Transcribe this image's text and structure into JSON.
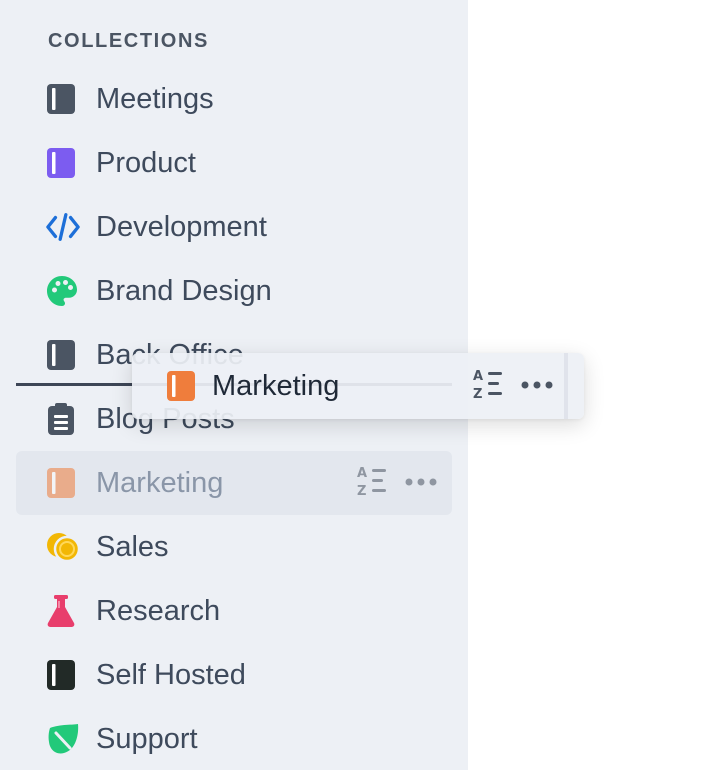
{
  "sidebar": {
    "section_title": "COLLECTIONS",
    "items": [
      {
        "label": "Meetings",
        "icon": "collection-icon",
        "color": "#4b5563"
      },
      {
        "label": "Product",
        "icon": "collection-icon",
        "color": "#7c5cf0"
      },
      {
        "label": "Development",
        "icon": "code-icon",
        "color": "#1d6fd8"
      },
      {
        "label": "Brand Design",
        "icon": "palette-icon",
        "color": "#22c97a"
      },
      {
        "label": "Back Office",
        "icon": "collection-icon",
        "color": "#4b5563"
      },
      {
        "label": "Blog Posts",
        "icon": "clipboard-icon",
        "color": "#4b5563"
      },
      {
        "label": "Marketing",
        "icon": "collection-icon",
        "color": "#ef7d3c"
      },
      {
        "label": "Sales",
        "icon": "coins-icon",
        "color": "#f2b705"
      },
      {
        "label": "Research",
        "icon": "flask-icon",
        "color": "#e83e6c"
      },
      {
        "label": "Self Hosted",
        "icon": "collection-icon",
        "color": "#222a27"
      },
      {
        "label": "Support",
        "icon": "leaf-icon",
        "color": "#22c97a"
      }
    ]
  },
  "drag": {
    "label": "Marketing",
    "icon": "collection-icon",
    "color": "#ef7d3c"
  }
}
